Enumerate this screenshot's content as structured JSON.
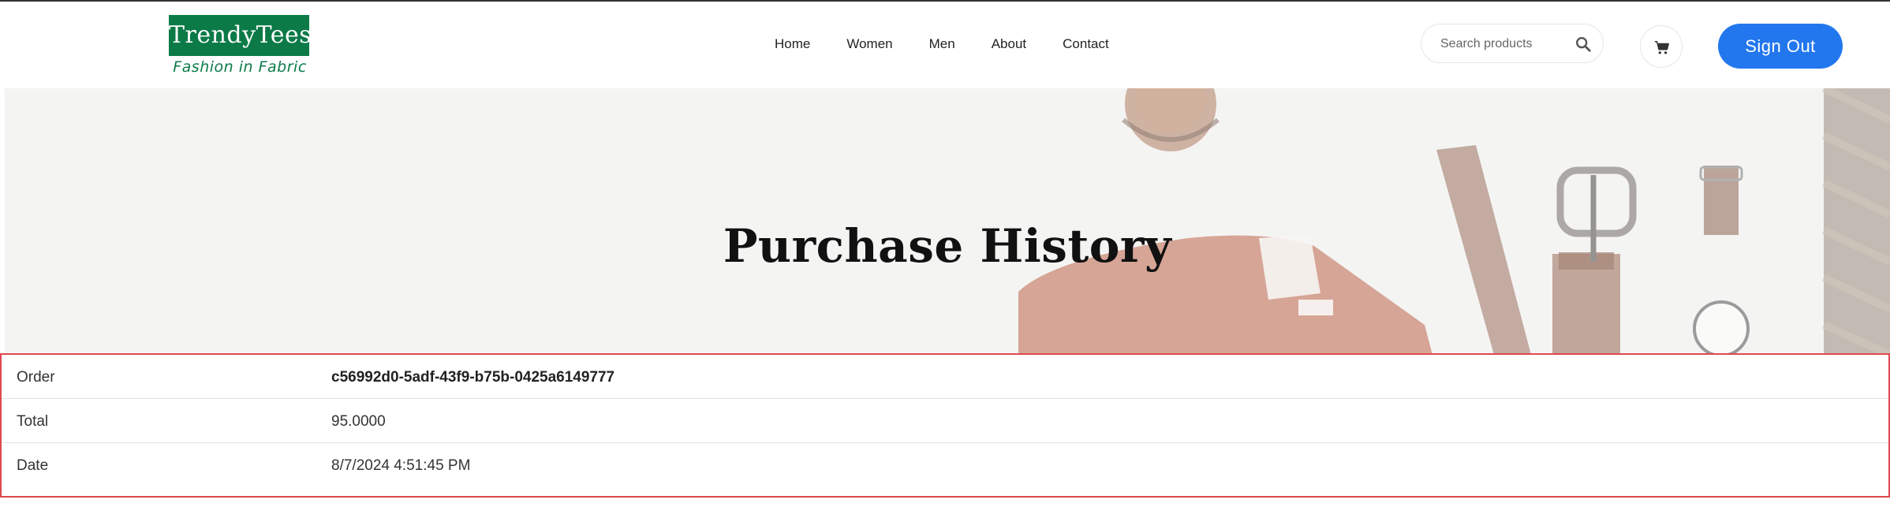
{
  "brand": {
    "name": "TrendyTees",
    "tagline": "Fashion in Fabric",
    "color": "#0b7a47"
  },
  "nav": {
    "items": [
      "Home",
      "Women",
      "Men",
      "About",
      "Contact"
    ]
  },
  "search": {
    "placeholder": "Search products",
    "icon": "search-icon"
  },
  "cart": {
    "icon": "cart-icon"
  },
  "auth": {
    "sign_out_label": "Sign Out",
    "color": "#2277ee"
  },
  "hero": {
    "title": "Purchase History"
  },
  "order": {
    "rows": [
      {
        "label": "Order",
        "value": "c56992d0-5adf-43f9-b75b-0425a6149777"
      },
      {
        "label": "Total",
        "value": "95.0000"
      },
      {
        "label": "Date",
        "value": "8/7/2024 4:51:45 PM"
      }
    ],
    "border_color": "#e0484f"
  }
}
